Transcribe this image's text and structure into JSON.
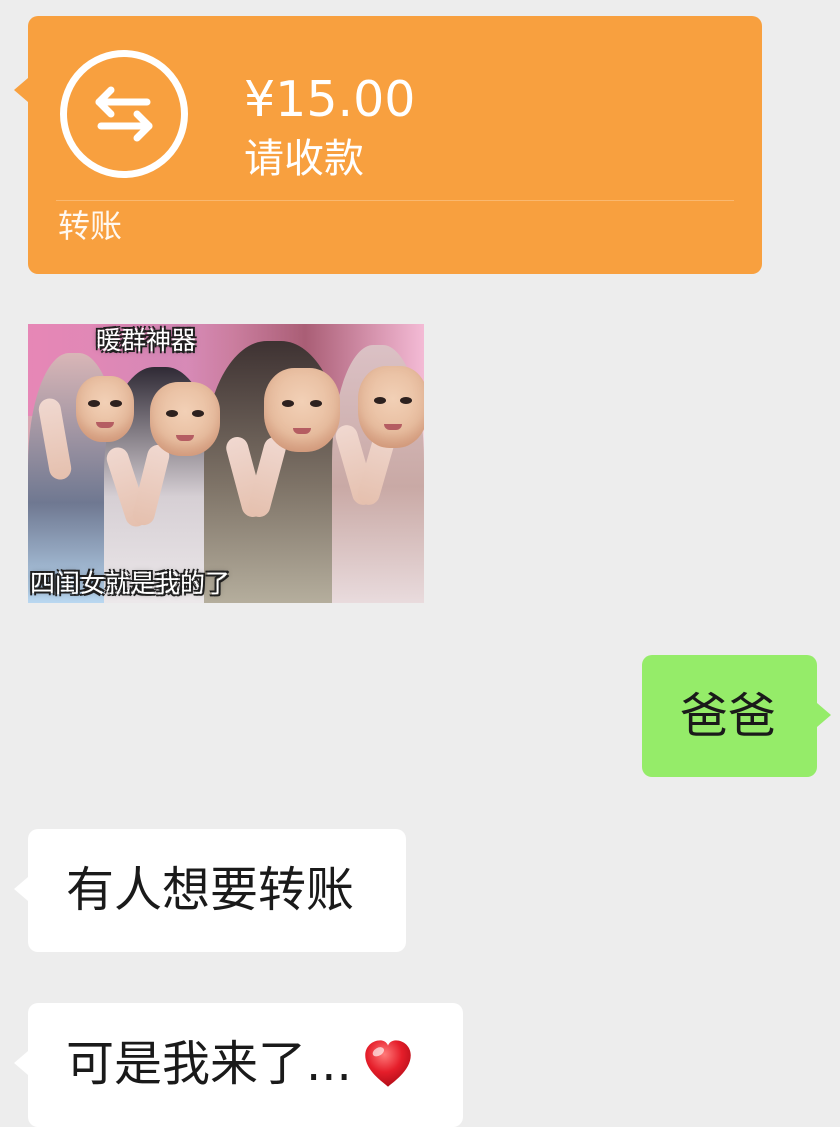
{
  "transfer": {
    "amount": "¥15.00",
    "status": "请收款",
    "footer": "转账",
    "icon": "transfer-icon",
    "color": "#f8a03f"
  },
  "sticker": {
    "top_caption": "暖群神器",
    "bottom_caption": "四闺女就是我的了"
  },
  "messages": [
    {
      "side": "right",
      "text": "爸爸",
      "color": "#95ec69"
    },
    {
      "side": "left",
      "text": "有人想要转账",
      "color": "#ffffff"
    },
    {
      "side": "left",
      "text": "可是我来了...",
      "emoji_icon": "heart-icon",
      "color": "#ffffff"
    }
  ],
  "background_color": "#ededed"
}
